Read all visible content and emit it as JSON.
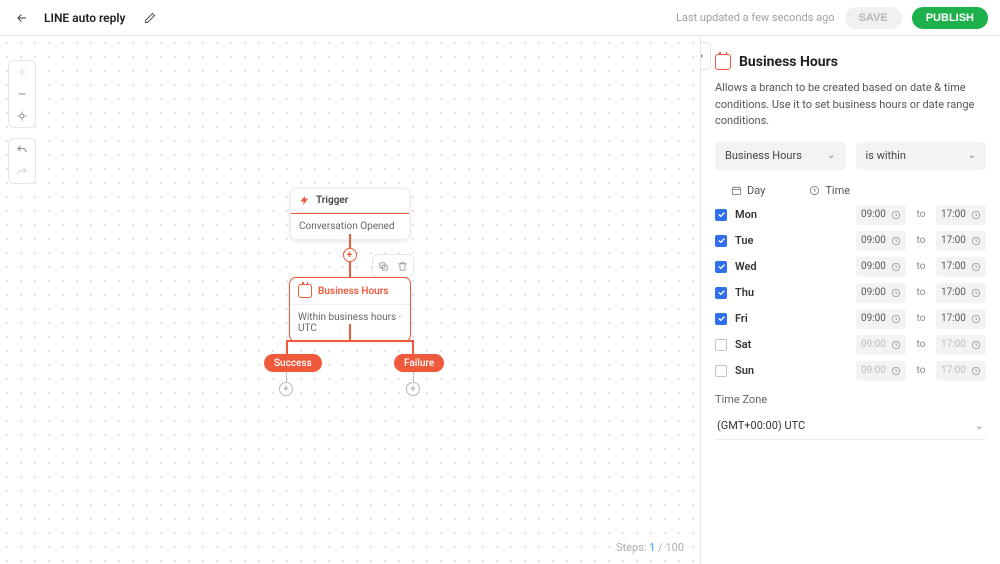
{
  "header": {
    "title": "LINE auto reply",
    "last_updated": "Last updated a few seconds ago",
    "save_label": "SAVE",
    "publish_label": "PUBLISH"
  },
  "canvas": {
    "trigger": {
      "title": "Trigger",
      "subtitle": "Conversation Opened"
    },
    "business_hours_node": {
      "title": "Business Hours",
      "subtitle": "Within business hours · UTC"
    },
    "branch_success": "Success",
    "branch_failure": "Failure",
    "steps_label": "Steps:",
    "steps_current": "1",
    "steps_sep": " / ",
    "steps_total": "100"
  },
  "panel": {
    "title": "Business Hours",
    "description": "Allows a branch to be created based on date & time conditions. Use it to set business hours or date range conditions.",
    "dropdown_type": "Business Hours",
    "dropdown_operator": "is within",
    "col_day": "Day",
    "col_time": "Time",
    "to_label": "to",
    "days": [
      {
        "key": "mon",
        "label": "Mon",
        "enabled": true,
        "from": "09:00",
        "to": "17:00"
      },
      {
        "key": "tue",
        "label": "Tue",
        "enabled": true,
        "from": "09:00",
        "to": "17:00"
      },
      {
        "key": "wed",
        "label": "Wed",
        "enabled": true,
        "from": "09:00",
        "to": "17:00"
      },
      {
        "key": "thu",
        "label": "Thu",
        "enabled": true,
        "from": "09:00",
        "to": "17:00"
      },
      {
        "key": "fri",
        "label": "Fri",
        "enabled": true,
        "from": "09:00",
        "to": "17:00"
      },
      {
        "key": "sat",
        "label": "Sat",
        "enabled": false,
        "from": "09:00",
        "to": "17:00"
      },
      {
        "key": "sun",
        "label": "Sun",
        "enabled": false,
        "from": "09:00",
        "to": "17:00"
      }
    ],
    "timezone_label": "Time Zone",
    "timezone_value": "(GMT+00:00) UTC"
  }
}
